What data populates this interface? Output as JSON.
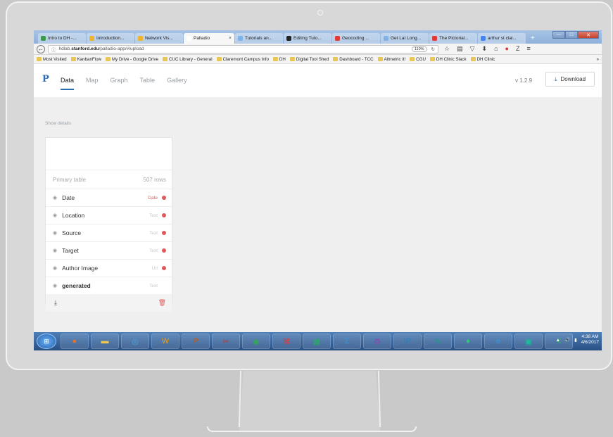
{
  "browser": {
    "tabs": [
      {
        "label": "Intro to DH -...",
        "color": "#3b9b4d",
        "active": false
      },
      {
        "label": "Introduction...",
        "color": "#f0b429",
        "active": false
      },
      {
        "label": "Network Vis...",
        "color": "#f0b429",
        "active": false
      },
      {
        "label": "Palladio",
        "color": "#ffffff",
        "active": true
      },
      {
        "label": "Tutorials an...",
        "color": "#7fb2e5",
        "active": false
      },
      {
        "label": "Editing Tuto...",
        "color": "#222222",
        "active": false
      },
      {
        "label": "Geocoding ...",
        "color": "#e53935",
        "active": false
      },
      {
        "label": "Get Lat Long...",
        "color": "#7fb2e5",
        "active": false
      },
      {
        "label": "The Pictorial...",
        "color": "#e53935",
        "active": false
      },
      {
        "label": "arthur st clai...",
        "color": "#4285f4",
        "active": false
      }
    ],
    "new_tab": "+",
    "window_buttons": {
      "minimize": "—",
      "maximize": "□",
      "close": "✕"
    },
    "url_prefix": "hdlab.",
    "url_host": "stanford.edu",
    "url_path": "/palladio-app/#/upload",
    "zoom": "110%",
    "bookmarks": [
      "Most Visited",
      "KanbanFlow",
      "My Drive - Google Drive",
      "CUC Library - General",
      "Claremont Campus Info",
      "DH",
      "Digital Tool Shed",
      "Dashboard - TCC",
      "Altmetric it!",
      "CGU",
      "DH Clinic Slack",
      "DH Clinic"
    ],
    "bookmarks_more": "»"
  },
  "app": {
    "logo": "P",
    "nav": [
      "Data",
      "Map",
      "Graph",
      "Table",
      "Gallery"
    ],
    "active_nav": "Data",
    "version": "v 1.2.9",
    "download_label": "Download",
    "show_details": "Show details",
    "table": {
      "title": "Primary table",
      "rows_count": "507 rows",
      "fields": [
        {
          "name": "Date",
          "type": "Date",
          "error": true,
          "type_error": true,
          "bold": false
        },
        {
          "name": "Location",
          "type": "Text",
          "error": true,
          "type_error": false,
          "bold": false
        },
        {
          "name": "Source",
          "type": "Text",
          "error": true,
          "type_error": false,
          "bold": false
        },
        {
          "name": "Target",
          "type": "Text",
          "error": true,
          "type_error": false,
          "bold": false
        },
        {
          "name": "Author Image",
          "type": "Url",
          "error": true,
          "type_error": false,
          "bold": false
        },
        {
          "name": "generated",
          "type": "Text",
          "error": false,
          "type_error": false,
          "bold": true
        }
      ]
    }
  },
  "taskbar": {
    "start": "⊞",
    "apps": [
      "firefox",
      "explorer",
      "outlook",
      "word",
      "ppt",
      "snip",
      "chrome",
      "acrobat",
      "excel-chart",
      "sigma",
      "network",
      "ipv",
      "paint",
      "evernote",
      "ie",
      "cube",
      "excel"
    ],
    "time": "4:38 AM",
    "date": "4/6/2017"
  }
}
